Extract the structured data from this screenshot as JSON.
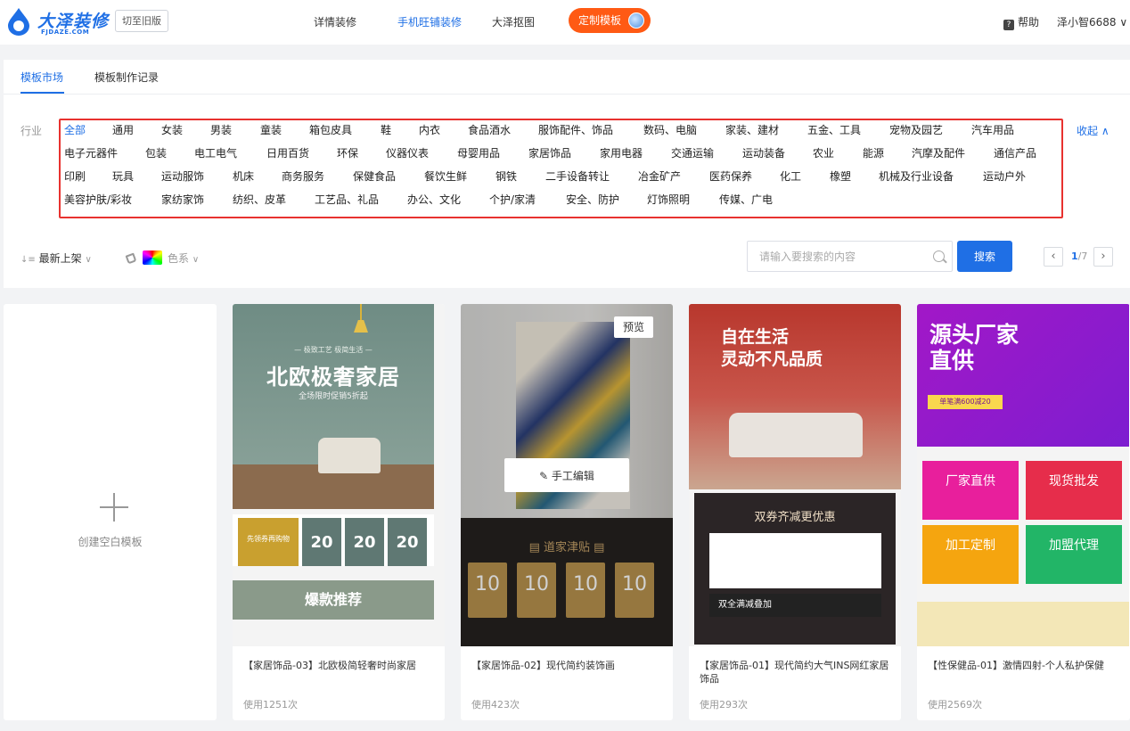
{
  "header": {
    "logo_text": "大泽装修",
    "logo_sub": "FJDAZE.COM",
    "switch_label": "切至旧版",
    "nav": [
      "详情装修",
      "手机旺铺装修",
      "大泽抠图"
    ],
    "nav_active_index": 1,
    "custom_template_label": "定制模板",
    "help_label": "帮助",
    "help_icon": "question-icon",
    "user_label": "泽小智6688 ∨"
  },
  "tabs": [
    "模板市场",
    "模板制作记录"
  ],
  "filters": {
    "industry_label": "行业",
    "collapse_label": "收起 ∧",
    "categories": [
      [
        "全部",
        "通用",
        "女装",
        "男装",
        "童装",
        "箱包皮具",
        "鞋",
        "内衣",
        "食品酒水",
        "服饰配件、饰品",
        "数码、电脑",
        "家装、建材",
        "五金、工具",
        "宠物及园艺",
        "汽车用品"
      ],
      [
        "电子元器件",
        "包装",
        "电工电气",
        "日用百货",
        "环保",
        "仪器仪表",
        "母婴用品",
        "家居饰品",
        "家用电器",
        "交通运输",
        "运动装备",
        "农业",
        "能源",
        "汽摩及配件",
        "通信产品"
      ],
      [
        "印刷",
        "玩具",
        "运动服饰",
        "机床",
        "商务服务",
        "保健食品",
        "餐饮生鲜",
        "钢铁",
        "二手设备转让",
        "冶金矿产",
        "医药保养",
        "化工",
        "橡塑",
        "机械及行业设备",
        "运动户外"
      ],
      [
        "美容护肤/彩妆",
        "家纺家饰",
        "纺织、皮革",
        "工艺品、礼品",
        "办公、文化",
        "个护/家清",
        "安全、防护",
        "灯饰照明",
        "传媒、广电"
      ]
    ],
    "active_category": "全部",
    "sort_label": "最新上架",
    "color_label": "色系",
    "search_placeholder": "请输入要搜索的内容",
    "search_button": "搜索",
    "page_current": "1",
    "page_total": "/7"
  },
  "blank_card": {
    "label": "创建空白模板"
  },
  "templates": [
    {
      "title": "【家居饰品-03】北欧极简轻奢时尚家居",
      "uses": "使用1251次",
      "thumb": {
        "small": "— 极致工艺 极简生活 —",
        "big": "北欧极奢家居",
        "sub": "全场限时促销5折起",
        "coupon_label": "先领券再购物",
        "coupon_values": [
          "20",
          "20",
          "20"
        ],
        "bottom": "爆款推荐"
      }
    },
    {
      "title": "【家居饰品-02】现代简约装饰画",
      "uses": "使用423次",
      "preview_label": "预览",
      "edit_label": "✎ 手工编辑",
      "thumb": {
        "gold": "▤ 道家津贴 ▤",
        "coupon_values": [
          "10",
          "10",
          "10",
          "10"
        ]
      }
    },
    {
      "title": "【家居饰品-01】现代简约大气INS网红家居饰品",
      "uses": "使用293次",
      "thumb": {
        "title_line1": "自在生活",
        "title_line2": "灵动不凡品质",
        "dark_title": "双券齐减更优惠",
        "bottom": "双全满减叠加"
      }
    },
    {
      "title": "【性保健品-01】激情四射-个人私护保健",
      "uses": "使用2569次",
      "thumb": {
        "title_line1": "源头厂家",
        "title_line2": "直供",
        "tag": "单笔满600减20",
        "boxes": [
          "厂家直供",
          "现货批发",
          "加工定制",
          "加盟代理"
        ]
      }
    }
  ]
}
